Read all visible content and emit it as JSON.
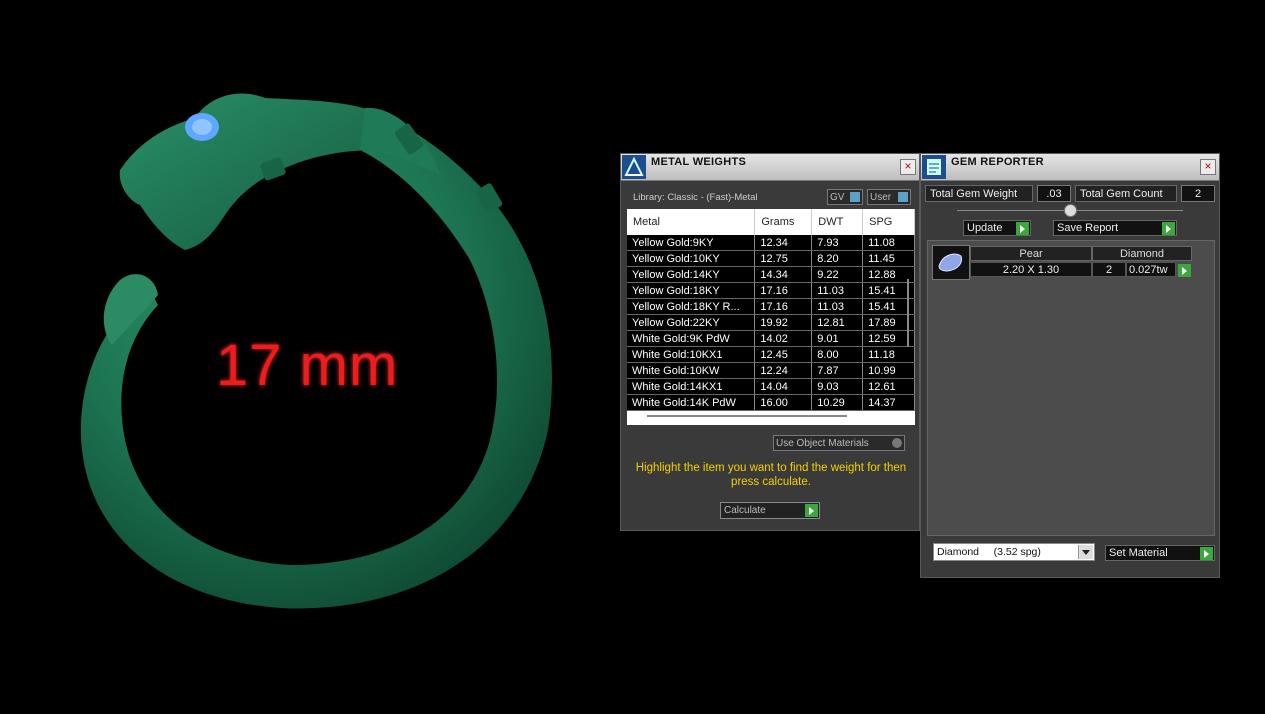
{
  "model": {
    "ring_color": "#1f7a58",
    "eye_color": "#5fa8ff",
    "dimension_label": "17 mm",
    "label_color": "#ee1c1c"
  },
  "metal_weights": {
    "title": "METAL WEIGHTS",
    "library": "Library: Classic - (Fast)-Metal",
    "gv_label": "GV",
    "user_label": "User",
    "columns": [
      "Metal",
      "Grams",
      "DWT",
      "SPG"
    ],
    "rows": [
      [
        "Yellow Gold:9KY",
        "12.34",
        "7.93",
        "11.08"
      ],
      [
        "Yellow Gold:10KY",
        "12.75",
        "8.20",
        "11.45"
      ],
      [
        "Yellow Gold:14KY",
        "14.34",
        "9.22",
        "12.88"
      ],
      [
        "Yellow Gold:18KY",
        "17.16",
        "11.03",
        "15.41"
      ],
      [
        "Yellow Gold:18KY R...",
        "17.16",
        "11.03",
        "15.41"
      ],
      [
        "Yellow Gold:22KY",
        "19.92",
        "12.81",
        "17.89"
      ],
      [
        "White Gold:9K PdW",
        "14.02",
        "9.01",
        "12.59"
      ],
      [
        "White Gold:10KX1",
        "12.45",
        "8.00",
        "11.18"
      ],
      [
        "White Gold:10KW",
        "12.24",
        "7.87",
        "10.99"
      ],
      [
        "White Gold:14KX1",
        "14.04",
        "9.03",
        "12.61"
      ],
      [
        "White Gold:14K PdW",
        "16.00",
        "10.29",
        "14.37"
      ]
    ],
    "use_object_materials": "Use Object Materials",
    "instruction": "Highlight the item you want to find the weight for then press calculate.",
    "calculate": "Calculate"
  },
  "gem_reporter": {
    "title": "GEM REPORTER",
    "total_gem_weight_label": "Total Gem Weight",
    "total_gem_weight": ".03",
    "total_gem_count_label": "Total Gem Count",
    "total_gem_count": "2",
    "update": "Update",
    "save_report": "Save Report",
    "gem": {
      "shape": "Pear",
      "size": "2.20 X 1.30",
      "material": "Diamond",
      "count": "2",
      "weight": "0.027tw"
    },
    "material_select": "Diamond     (3.52 spg)",
    "set_material": "Set Material"
  }
}
